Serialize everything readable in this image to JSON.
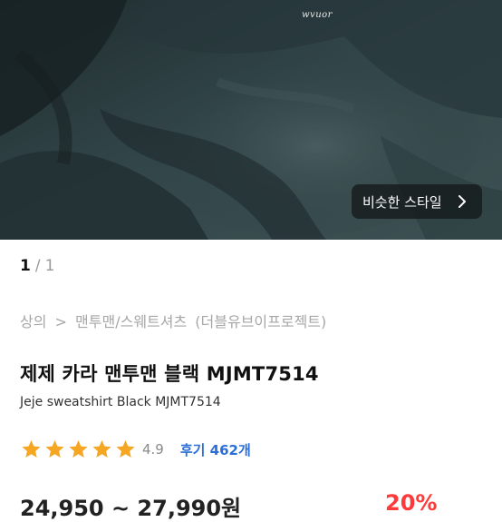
{
  "gallery": {
    "logo_text": "wvuor",
    "similar_style_label": "비슷한 스타일",
    "current_page": "1",
    "page_separator": "/",
    "total_pages": "1"
  },
  "breadcrumb": {
    "items": [
      "상의",
      ">",
      "맨투맨/스웨트셔츠",
      "(더블유브이프로젝트)"
    ]
  },
  "product": {
    "title": "제제 카라 맨투맨 블랙 MJMT7514",
    "subtitle": "Jeje sweatshirt Black MJMT7514",
    "rating": "4.9",
    "stars_filled": 5,
    "review_label": "후기 462개",
    "price_text": "24,950 ~ 27,990원",
    "discount_text": "20%"
  },
  "colors": {
    "star": "#f5a623",
    "review_link": "#2b6fd6",
    "discount": "#ff3a3a"
  }
}
